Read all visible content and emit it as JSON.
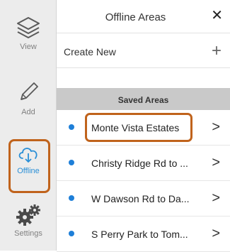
{
  "sidebar": {
    "items": [
      {
        "label": "View",
        "icon": "layers-icon"
      },
      {
        "label": "Add",
        "icon": "pencil-icon"
      },
      {
        "label": "Offline",
        "icon": "cloud-download-icon"
      },
      {
        "label": "Settings",
        "icon": "gears-icon"
      }
    ],
    "active_color": "#2a8fd6",
    "inactive_color": "#808080"
  },
  "panel": {
    "title": "Offline Areas",
    "close_glyph": "✕",
    "create_label": "Create New",
    "create_glyph": "+",
    "section_label": "Saved Areas",
    "areas": [
      {
        "name": "Monte Vista Estates"
      },
      {
        "name": "Christy Ridge Rd to ..."
      },
      {
        "name": "W Dawson Rd to Da..."
      },
      {
        "name": "S Perry Park to Tom..."
      }
    ]
  },
  "highlight_color": "#c0631c",
  "dot_color": "#1e7fd8"
}
